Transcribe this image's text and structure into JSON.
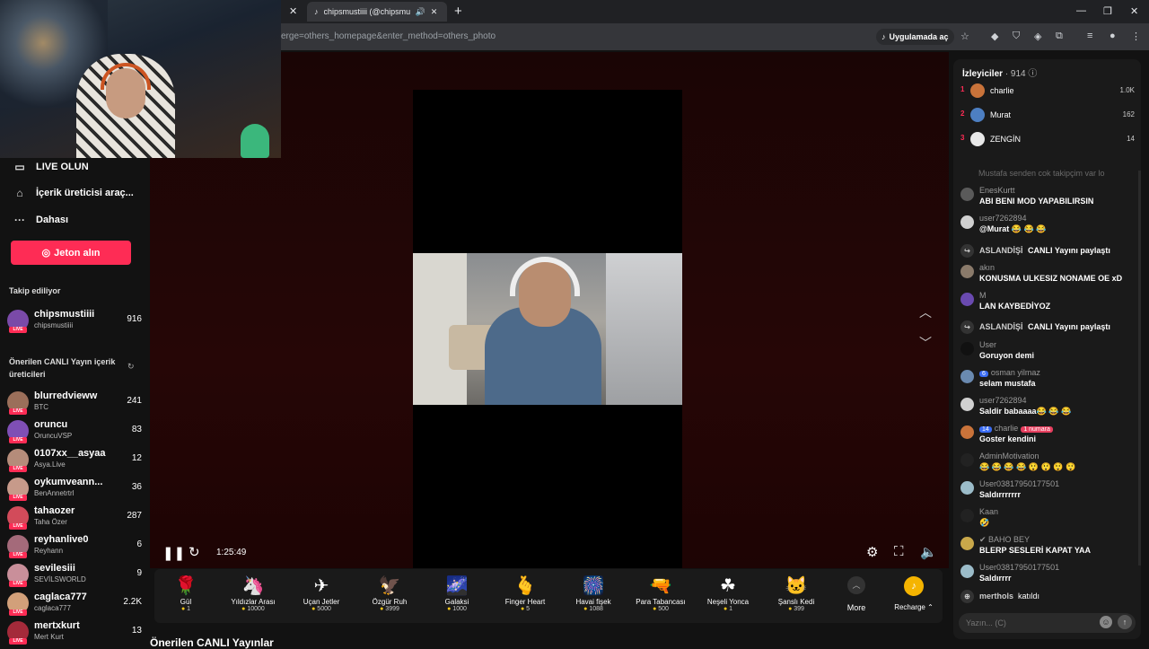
{
  "browser": {
    "prev_tab_title": "",
    "tab_title": "chipsmustiiii (@chipsmusti",
    "url": "erge=others_homepage&enter_method=others_photo",
    "open_in_app": "Uygulamada aç"
  },
  "sidebar": {
    "nav": [
      {
        "label": "LIVE OLUN",
        "icon": "video-camera-icon"
      },
      {
        "label": "İçerik üreticisi araç...",
        "icon": "creator-tools-icon"
      },
      {
        "label": "Dahası",
        "icon": "more-dots-icon"
      }
    ],
    "coin_button": "Jeton alın",
    "following_title": "Takip ediliyor",
    "following": [
      {
        "name": "chipsmustiiii",
        "handle": "chipsmustiiii",
        "count": "916",
        "color": "#7a4aa8"
      }
    ],
    "recommended_title": "Önerilen CANLI Yayın içerik üreticileri",
    "recommended": [
      {
        "name": "blurredvieww",
        "handle": "BTC",
        "count": "241",
        "color": "#9b6f5a"
      },
      {
        "name": "oruncu",
        "handle": "OruncuVSP",
        "count": "83",
        "color": "#7f4fb5"
      },
      {
        "name": "0107xx__asyaa",
        "handle": "Asya.Live",
        "count": "12",
        "color": "#b58c7a"
      },
      {
        "name": "oykumveann...",
        "handle": "BenAnnetrtrl",
        "count": "36",
        "color": "#c79a8a"
      },
      {
        "name": "tahaozer",
        "handle": "Taha Özer",
        "count": "287",
        "color": "#d24b5a"
      },
      {
        "name": "reyhanlive0",
        "handle": "Reyhann",
        "count": "6",
        "color": "#a46a7a"
      },
      {
        "name": "sevilesiii",
        "handle": "SEVİLSWORLD",
        "count": "9",
        "color": "#c98f9a"
      },
      {
        "name": "caglaca777",
        "handle": "caglaca777",
        "count": "2.2K",
        "color": "#d2a07a"
      },
      {
        "name": "mertxkurt",
        "handle": "Mert Kurt",
        "count": "13",
        "color": "#a42a3a"
      }
    ]
  },
  "player": {
    "time": "1:25:49"
  },
  "gifts": [
    {
      "name": "Gül",
      "price": "1",
      "icon": "🌹"
    },
    {
      "name": "Yıldızlar Arası",
      "price": "10000",
      "icon": "🦄"
    },
    {
      "name": "Uçan Jetler",
      "price": "5000",
      "icon": "✈"
    },
    {
      "name": "Özgür Ruh",
      "price": "3999",
      "icon": "🦅"
    },
    {
      "name": "Galaksi",
      "price": "1000",
      "icon": "🌌"
    },
    {
      "name": "Finger Heart",
      "price": "5",
      "icon": "🫰"
    },
    {
      "name": "Havai fişek",
      "price": "1088",
      "icon": "🎆"
    },
    {
      "name": "Para Tabancası",
      "price": "500",
      "icon": "🔫"
    },
    {
      "name": "Neşeli Yonca",
      "price": "1",
      "icon": "☘"
    },
    {
      "name": "Şanslı Kedi",
      "price": "399",
      "icon": "🐱"
    }
  ],
  "gift_more": "More",
  "recharge": "Recharge",
  "bottom_title": "Önerilen CANLI Yayınlar",
  "chat": {
    "viewers_label": "İzleyiciler",
    "viewers_count": "· 914",
    "top_viewers": [
      {
        "rank": "1",
        "name": "charlie",
        "score": "1.0K",
        "color": "#c9733a"
      },
      {
        "rank": "2",
        "name": "Murat",
        "score": "162",
        "color": "#4d7fc2"
      },
      {
        "rank": "3",
        "name": "ZENGİN",
        "score": "14",
        "color": "#e8e8e8"
      }
    ],
    "faded_message": "Mustafa senden cok takipçim var lo",
    "messages": [
      {
        "type": "msg",
        "user": "EnesKurtt",
        "text": "ABI BENI MOD YAPABILIRSIN",
        "color": "#5a5a5a"
      },
      {
        "type": "msg",
        "user": "user7262894",
        "text": "@Murat 😂 😂 😂",
        "color": "#d0d0d0"
      },
      {
        "type": "share",
        "user": "ASLANDİŞİ",
        "text": "CANLI Yayını paylaştı"
      },
      {
        "type": "msg",
        "user": "akın",
        "text": "KONUSMA ULKESIZ NONAME OE xD",
        "color": "#8a7a6a"
      },
      {
        "type": "msg",
        "user": "M",
        "text": "LAN KAYBEDİYOZ",
        "color": "#6a4ab0"
      },
      {
        "type": "share",
        "user": "ASLANDİŞİ",
        "text": "CANLI Yayını paylaştı"
      },
      {
        "type": "msg",
        "user": "User",
        "text": "Goruyon demi",
        "color": "#111111"
      },
      {
        "type": "msg",
        "user": "osman yilmaz",
        "badge": "6",
        "text": "selam mustafa",
        "color": "#6a8ab0"
      },
      {
        "type": "msg",
        "user": "user7262894",
        "text": "Saldir babaaaa😂 😂 😂",
        "color": "#d0d0d0"
      },
      {
        "type": "msg",
        "user": "charlie",
        "badge": "14",
        "badge2": "1 numara",
        "text": "Goster kendini",
        "color": "#c9733a"
      },
      {
        "type": "msg",
        "user": "AdminMotivation",
        "text": "😂 😂 😂 😂 😲 😲 😲 😲",
        "color": "#222222"
      },
      {
        "type": "msg",
        "user": "User03817950177501",
        "text": "Saldırrrrrrr",
        "color": "#9bbcc9"
      },
      {
        "type": "msg",
        "user": "Kaan",
        "text": "🤣",
        "color": "#222222"
      },
      {
        "type": "msg",
        "user": "✔ BAHO BEY",
        "text": "BLERP SESLERİ KAPAT YAA",
        "color": "#c9a84a"
      },
      {
        "type": "msg",
        "user": "User03817950177501",
        "text": "Saldırrrr",
        "color": "#9bbcc9"
      },
      {
        "type": "join",
        "user": "merthols",
        "text": "katıldı"
      }
    ],
    "input_placeholder": "Yazın... (C)"
  }
}
